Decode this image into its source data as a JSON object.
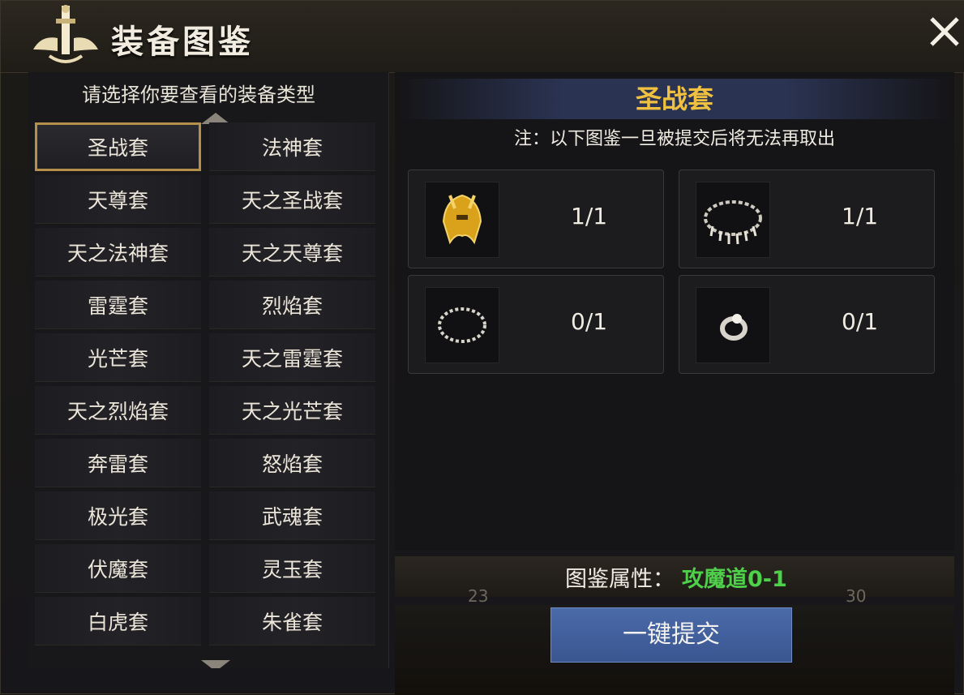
{
  "window": {
    "title": "装备图鉴",
    "close_icon": "close-x-icon"
  },
  "left": {
    "prompt": "请选择你要查看的装备类型",
    "sets": [
      {
        "label": "圣战套",
        "selected": true
      },
      {
        "label": "法神套"
      },
      {
        "label": "天尊套"
      },
      {
        "label": "天之圣战套"
      },
      {
        "label": "天之法神套"
      },
      {
        "label": "天之天尊套"
      },
      {
        "label": "雷霆套"
      },
      {
        "label": "烈焰套"
      },
      {
        "label": "光芒套"
      },
      {
        "label": "天之雷霆套"
      },
      {
        "label": "天之烈焰套"
      },
      {
        "label": "天之光芒套"
      },
      {
        "label": "奔雷套"
      },
      {
        "label": "怒焰套"
      },
      {
        "label": "极光套"
      },
      {
        "label": "武魂套"
      },
      {
        "label": "伏魔套"
      },
      {
        "label": "灵玉套"
      },
      {
        "label": "白虎套"
      },
      {
        "label": "朱雀套"
      }
    ]
  },
  "right": {
    "set_title": "圣战套",
    "note": "注：以下图鉴一旦被提交后将无法再取出",
    "items": [
      {
        "icon": "helmet-icon",
        "count": "1/1"
      },
      {
        "icon": "necklace-icon",
        "count": "1/1"
      },
      {
        "icon": "bracelet-icon",
        "count": "0/1"
      },
      {
        "icon": "ring-icon",
        "count": "0/1"
      }
    ],
    "attr_label": "图鉴属性：",
    "attr_value": "攻魔道0-1",
    "submit_label": "一键提交"
  },
  "background": {
    "numbers": [
      "23",
      "30"
    ]
  },
  "colors": {
    "set_title": "#f0c040",
    "attr_value": "#4ed04a",
    "button": "#3a5691",
    "selected_border": "#b6904a"
  }
}
